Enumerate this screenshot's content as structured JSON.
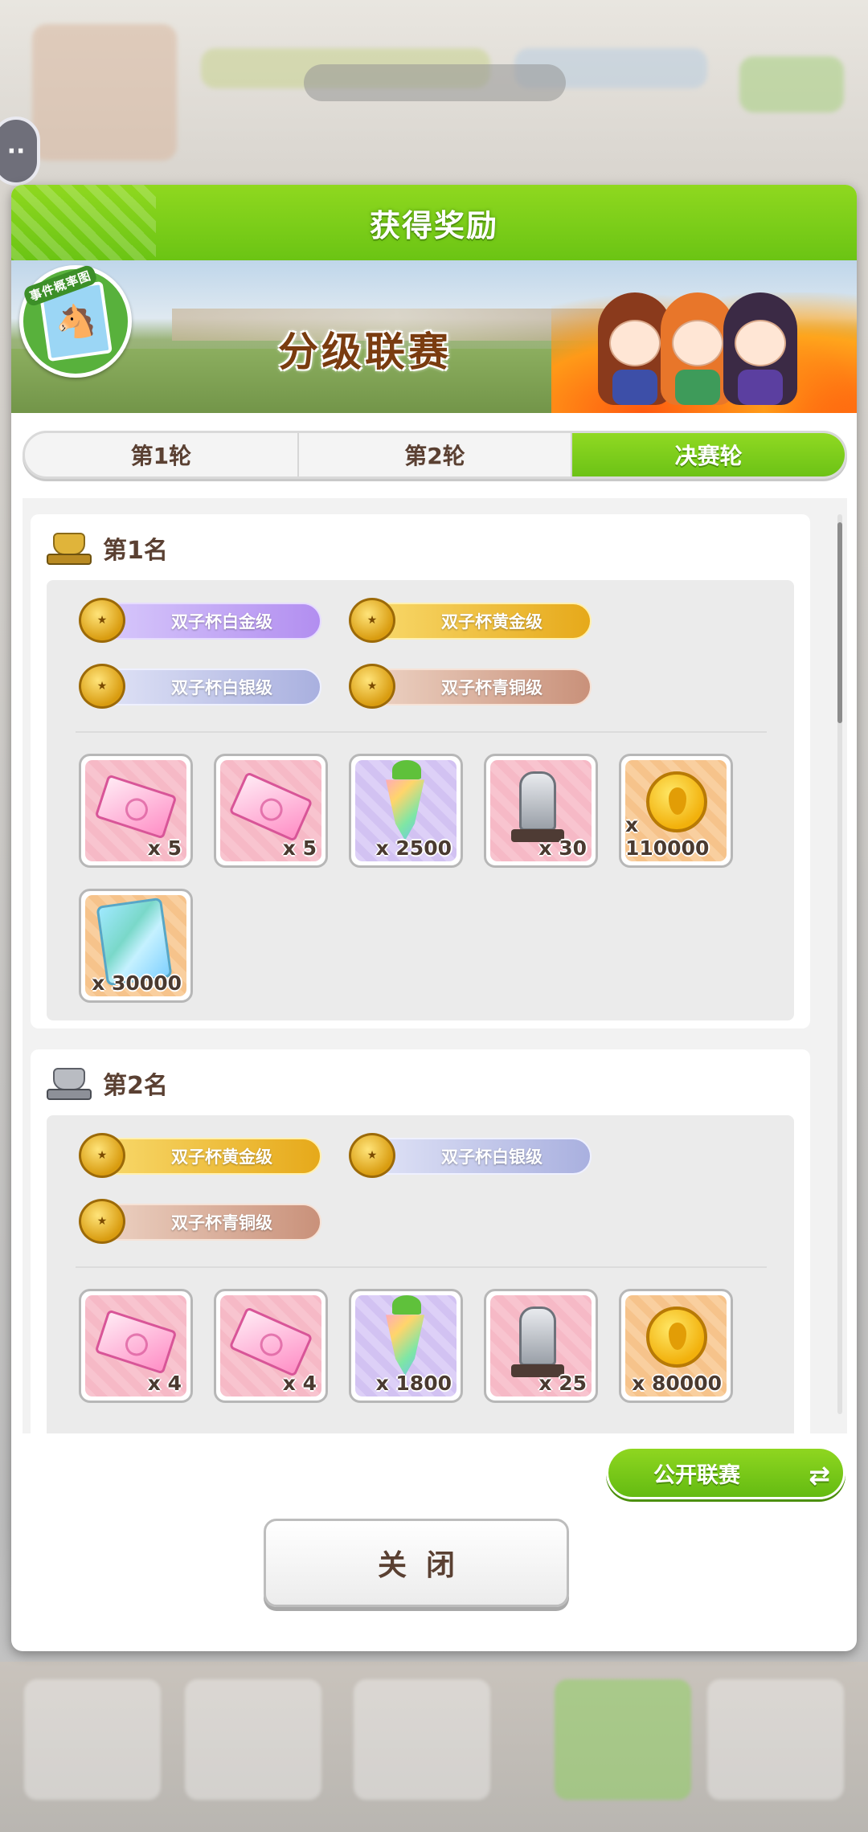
{
  "dialog": {
    "title": "获得奖励",
    "banner_title": "分级联赛",
    "event_badge_label": "事件概率图"
  },
  "tabs": [
    {
      "label": "第1轮",
      "active": false
    },
    {
      "label": "第2轮",
      "active": false
    },
    {
      "label": "决赛轮",
      "active": true
    }
  ],
  "ranks": [
    {
      "label": "第1名",
      "trophy": "gold-trophy-icon",
      "cup_badges": [
        {
          "label": "双子杯白金级",
          "tier": "platinum"
        },
        {
          "label": "双子杯黄金级",
          "tier": "gold"
        },
        {
          "label": "双子杯白银级",
          "tier": "silver"
        },
        {
          "label": "双子杯青铜级",
          "tier": "bronze"
        }
      ],
      "items": [
        {
          "icon": "pink-ticket-icon",
          "qty": "x 5"
        },
        {
          "icon": "pink-ticket-alt-icon",
          "qty": "x 5"
        },
        {
          "icon": "rainbow-carrot-icon",
          "qty": "x 2500"
        },
        {
          "icon": "silver-statue-icon",
          "qty": "x 30"
        },
        {
          "icon": "gold-coin-icon",
          "qty": "x 110000"
        },
        {
          "icon": "rainbow-card-icon",
          "qty": "x 30000"
        }
      ]
    },
    {
      "label": "第2名",
      "trophy": "silver-trophy-icon",
      "cup_badges": [
        {
          "label": "双子杯黄金级",
          "tier": "gold"
        },
        {
          "label": "双子杯白银级",
          "tier": "silver"
        },
        {
          "label": "双子杯青铜级",
          "tier": "bronze"
        }
      ],
      "items": [
        {
          "icon": "pink-ticket-icon",
          "qty": "x 4"
        },
        {
          "icon": "pink-ticket-alt-icon",
          "qty": "x 4"
        },
        {
          "icon": "rainbow-carrot-icon",
          "qty": "x 1800"
        },
        {
          "icon": "silver-statue-icon",
          "qty": "x 25"
        },
        {
          "icon": "gold-coin-icon",
          "qty": "x 80000"
        }
      ]
    }
  ],
  "buttons": {
    "public_league": "公开联赛",
    "close": "关闭"
  },
  "colors": {
    "header_green": "#7acc17",
    "accent_brown": "#5a4032"
  }
}
